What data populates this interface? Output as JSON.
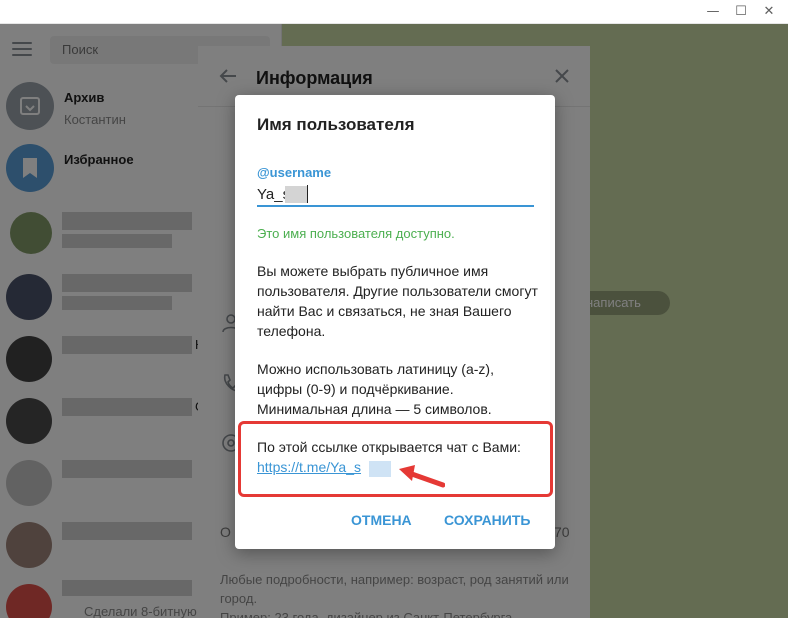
{
  "window": {
    "minimize": "—",
    "maximize": "☐",
    "close": "✕"
  },
  "sidebar": {
    "search_placeholder": "Поиск",
    "chats": [
      {
        "title": "Архив",
        "subtitle": "Костантин"
      },
      {
        "title": "Избранное",
        "subtitle": ""
      }
    ],
    "partial_labels": [
      "К",
      "G"
    ],
    "last_preview": "Сделали 8-битную"
  },
  "info_panel": {
    "title": "Информация",
    "number_suffix": "70",
    "row_initial": "О",
    "hint": "Любые подробности, например: возраст, род занятий или город.",
    "hint_partial": "Пример: 23 года, дизайнер из Санкт-Петербурга"
  },
  "chat_bg": {
    "pill_text": "написать"
  },
  "dialog": {
    "title": "Имя пользователя",
    "field_label": "@username",
    "field_value": "Ya_s",
    "available_text": "Это имя пользователя доступно.",
    "description": "Вы можете выбрать публичное имя пользователя. Другие пользователи смогут найти Вас и связаться, не зная Вашего телефона.",
    "rules": "Можно использовать латиницу (a-z), цифры (0-9) и подчёркивание. Минимальная длина — 5 символов.",
    "link_caption": "По этой ссылке открывается чат с Вами:",
    "link": "https://t.me/Ya_s",
    "cancel_label": "ОТМЕНА",
    "save_label": "СОХРАНИТЬ"
  },
  "colors": {
    "accent": "#3a95d5",
    "success": "#4caf50",
    "highlight": "#e53935",
    "chat_bg": "#c9d9a5"
  },
  "icons": [
    "menu-icon",
    "archive-icon",
    "saved-messages-icon",
    "back-arrow-icon",
    "close-icon",
    "user-icon",
    "phone-icon",
    "at-icon",
    "red-arrow-icon"
  ]
}
